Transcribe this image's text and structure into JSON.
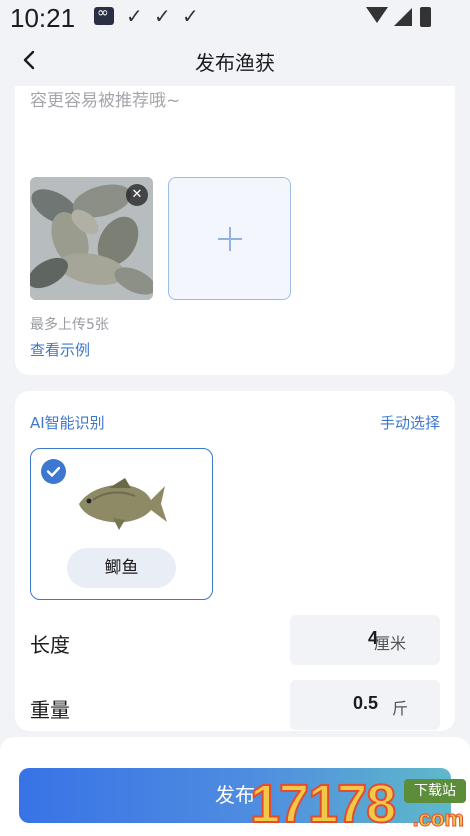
{
  "status_bar": {
    "time": "10:21",
    "icons": [
      "app-icon",
      "check-icon",
      "check-icon",
      "check-icon",
      "wifi-icon",
      "signal-icon",
      "battery-icon"
    ]
  },
  "nav": {
    "title": "发布渔获",
    "back_icon": "chevron-left-icon"
  },
  "post": {
    "description_placeholder": "容更容易被推荐哦~",
    "upload_hint": "最多上传5张",
    "example_link": "查看示例"
  },
  "species": {
    "ai_label": "AI智能识别",
    "manual_label": "手动选择",
    "selected_fish": "鲫鱼"
  },
  "fields": {
    "length_label": "长度",
    "length_value": "4",
    "length_unit": "厘米",
    "weight_label": "重量",
    "weight_value": "0.5",
    "weight_unit": "斤"
  },
  "actions": {
    "publish_label": "发布"
  },
  "watermark": {
    "number": "17178",
    "tag": "下载站",
    "domain": ".com"
  },
  "colors": {
    "accent": "#3d77cf",
    "background": "#f2f3f6",
    "button_gradient_start": "#3873e6",
    "button_gradient_end": "#5fb9c9"
  }
}
